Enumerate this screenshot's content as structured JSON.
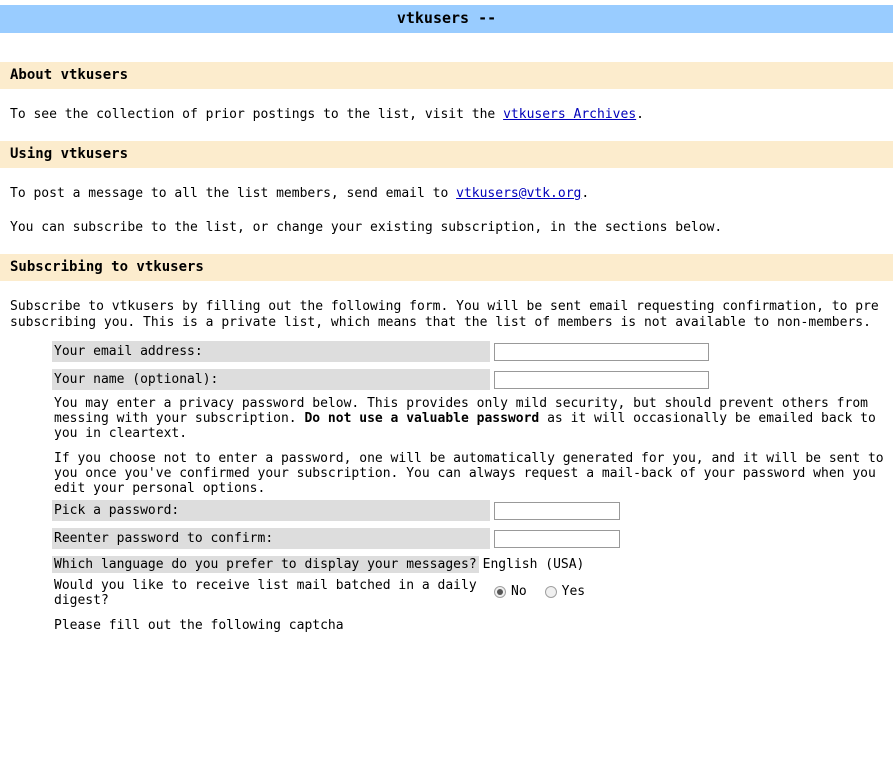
{
  "header": {
    "title": "vtkusers --"
  },
  "sections": {
    "about": {
      "heading": "About vtkusers",
      "paragraph_pre": "To see the collection of prior postings to the list, visit the ",
      "link_text": "vtkusers Archives",
      "paragraph_post": "."
    },
    "using": {
      "heading": "Using vtkusers",
      "post_pre": "To post a message to all the list members, send email to ",
      "post_link": "vtkusers@vtk.org",
      "post_post": ".",
      "subscribe_note": "You can subscribe to the list, or change your existing subscription, in the sections below."
    },
    "subscribing": {
      "heading": "Subscribing to vtkusers",
      "intro_line1": "Subscribe to vtkusers by filling out the following form. You will be sent email requesting confirmation, to pre",
      "intro_line2": "subscribing you. This is a private list, which means that the list of members is not available to non-members."
    }
  },
  "form": {
    "email_label": "Your email address:",
    "email_value": "",
    "name_label": "Your name (optional):",
    "name_value": "",
    "privacy_note_part1": "You may enter a privacy password below. This provides only mild security, but should prevent others from messing with your subscription. ",
    "privacy_note_bold": "Do not use a valuable password",
    "privacy_note_part2": " as it will occasionally be emailed back to you in cleartext.",
    "autogen_note": "If you choose not to enter a password, one will be automatically generated for you, and it will be sent to you once you've confirmed your subscription. You can always request a mail-back of your password when you edit your personal options.",
    "password_label": "Pick a password:",
    "password_value": "",
    "password_confirm_label": "Reenter password to confirm:",
    "password_confirm_value": "",
    "language_label": "Which language do you prefer to display your messages?",
    "language_value": "English (USA)",
    "digest_question": "Would you like to receive list mail batched in a daily digest?",
    "digest_no_label": "No",
    "digest_yes_label": "Yes",
    "digest_selected": "No",
    "captcha_prompt": "Please fill out the following captcha"
  },
  "colors": {
    "title_bar": "#99ccff",
    "section_heading_bg": "#fceccd",
    "label_cell_bg": "#dddddd",
    "link": "#0000bb",
    "page_bg": "#ffffff"
  }
}
